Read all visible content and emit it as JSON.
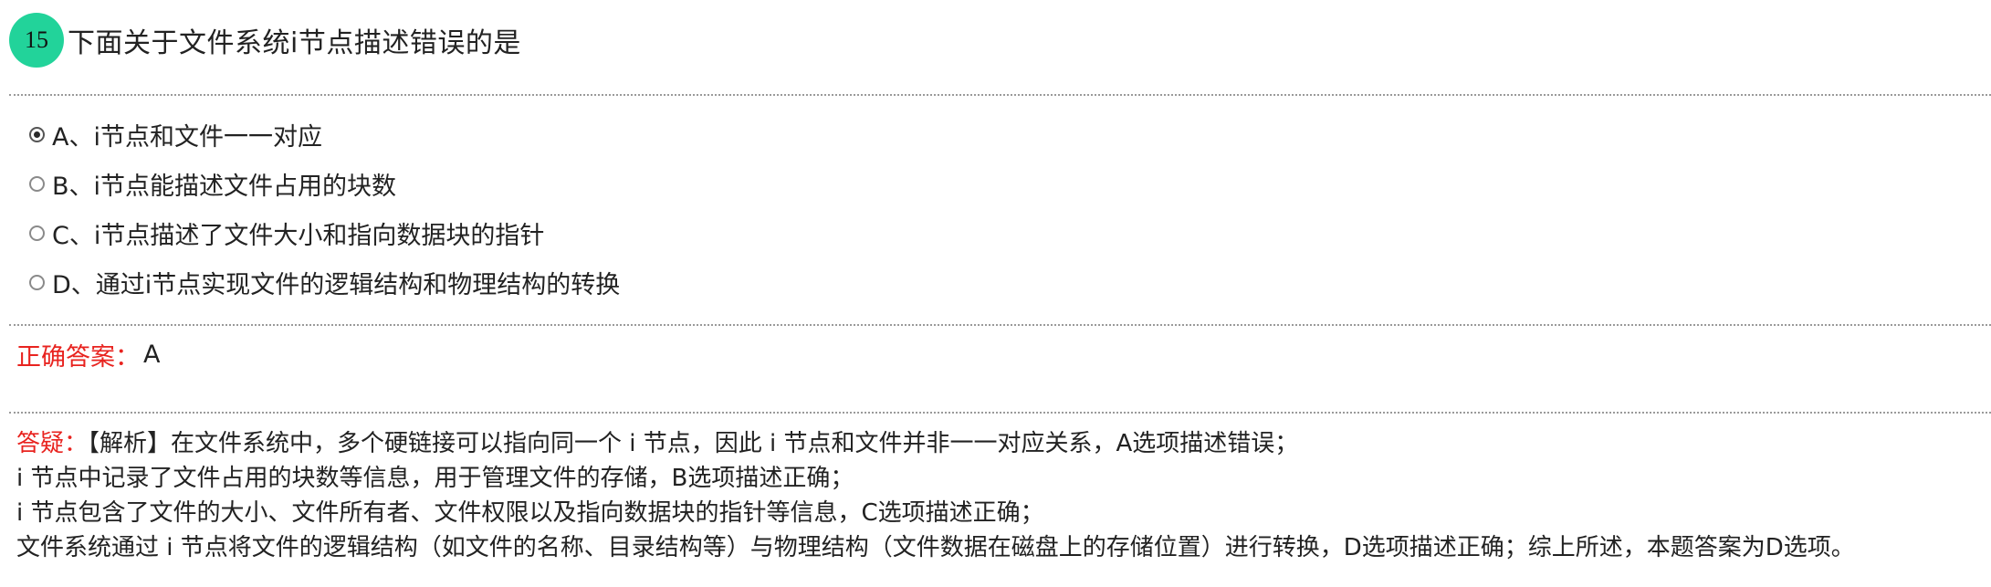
{
  "question": {
    "number": "15",
    "title": "下面关于文件系统i节点描述错误的是"
  },
  "options": [
    {
      "label": "A、i节点和文件一一对应",
      "selected": true
    },
    {
      "label": "B、i节点能描述文件占用的块数",
      "selected": false
    },
    {
      "label": "C、i节点描述了文件大小和指向数据块的指针",
      "selected": false
    },
    {
      "label": "D、通过i节点实现文件的逻辑结构和物理结构的转换",
      "selected": false
    }
  ],
  "answer": {
    "label": "正确答案：",
    "value": "A"
  },
  "explanation": {
    "label": "答疑：",
    "lines": [
      "【解析】在文件系统中，多个硬链接可以指向同一个 i 节点，因此 i 节点和文件并非一一对应关系，A选项描述错误；",
      "i 节点中记录了文件占用的块数等信息，用于管理文件的存储，B选项描述正确；",
      "i 节点包含了文件的大小、文件所有者、文件权限以及指向数据块的指针等信息，C选项描述正确；",
      "文件系统通过 i 节点将文件的逻辑结构（如文件的名称、目录结构等）与物理结构（文件数据在磁盘上的存储位置）进行转换，D选项描述正确；综上所述，本题答案为D选项。"
    ]
  },
  "colors": {
    "badge": "#22d39a",
    "label_red": "#e8231f",
    "divider": "#9a9a9a"
  }
}
